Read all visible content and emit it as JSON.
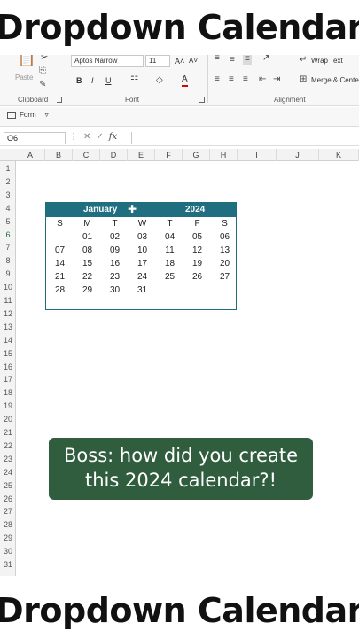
{
  "overlay": {
    "title_top": "Dropdown Calendar",
    "title_bottom": "Dropdown Calendar",
    "caption_line1": "Boss: how did you create",
    "caption_line2": "this 2024 calendar?!"
  },
  "ribbon": {
    "paste_label": "Paste",
    "clipboard_label": "Clipboard",
    "font_name": "Aptos Narrow",
    "font_size": "11",
    "grow_font": "A˄",
    "shrink_font": "A˅",
    "bold": "B",
    "italic": "I",
    "underline": "U",
    "font_color_letter": "A",
    "font_group_label": "Font",
    "wrap_text_label": "Wrap Text",
    "merge_center_label": "Merge & Center",
    "alignment_label": "Alignment"
  },
  "toolbar2": {
    "form_label": "Form"
  },
  "formula_bar": {
    "name_box": "O6",
    "fx_label": "fx",
    "formula": ""
  },
  "columns": [
    "A",
    "B",
    "C",
    "D",
    "E",
    "F",
    "G",
    "H",
    "I",
    "J",
    "K"
  ],
  "rows": [
    "1",
    "2",
    "3",
    "4",
    "5",
    "6",
    "7",
    "8",
    "9",
    "10",
    "11",
    "12",
    "13",
    "14",
    "15",
    "16",
    "17",
    "18",
    "19",
    "20",
    "21",
    "22",
    "23",
    "24",
    "25",
    "26",
    "27",
    "28",
    "29",
    "30",
    "31"
  ],
  "selected_row": "6",
  "calendar": {
    "month": "January",
    "year": "2024",
    "weekdays": [
      "S",
      "M",
      "T",
      "W",
      "T",
      "F",
      "S"
    ],
    "weeks": [
      [
        "",
        "01",
        "02",
        "03",
        "04",
        "05",
        "06"
      ],
      [
        "07",
        "08",
        "09",
        "10",
        "11",
        "12",
        "13"
      ],
      [
        "14",
        "15",
        "16",
        "17",
        "18",
        "19",
        "20"
      ],
      [
        "21",
        "22",
        "23",
        "24",
        "25",
        "26",
        "27"
      ],
      [
        "28",
        "29",
        "30",
        "31",
        "",
        "",
        ""
      ]
    ],
    "header_color": "#1f6f80"
  },
  "colors": {
    "caption_bg": "#2f5d3e",
    "accent": "#1f6f80"
  }
}
